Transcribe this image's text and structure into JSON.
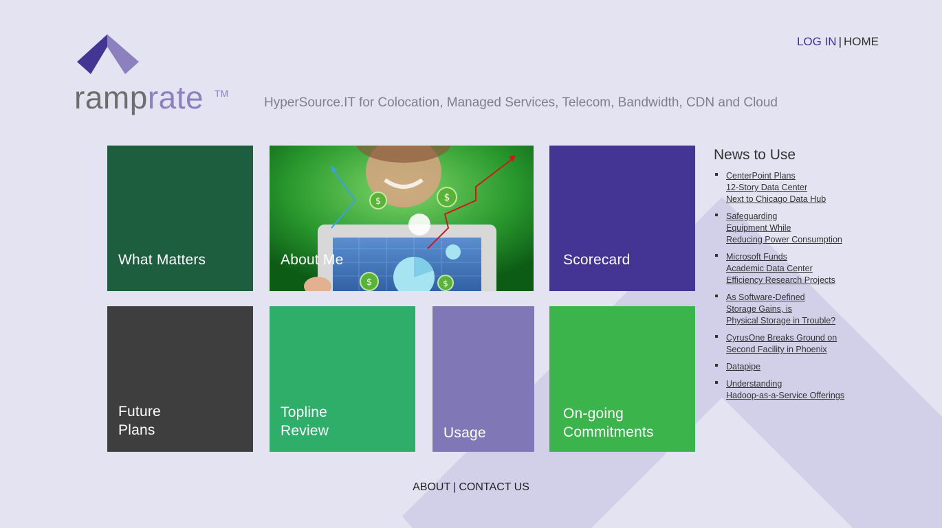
{
  "brand": {
    "word_ramp": "ramp",
    "word_rate": "rate",
    "tm": "TM",
    "tagline": "HyperSource.IT for Colocation, Managed Services, Telecom, Bandwidth, CDN and Cloud",
    "colors": {
      "accent": "#8d80be",
      "dark_accent": "#3e3490",
      "background": "#e4e3f1"
    }
  },
  "topnav": {
    "login": "LOG IN",
    "separator": "|",
    "home": "HOME"
  },
  "tiles": {
    "what_matters": {
      "label": "What Matters",
      "color": "#1c5e3e"
    },
    "about_me": {
      "label": "About Me"
    },
    "scorecard": {
      "label": "Scorecard",
      "color": "#443595"
    },
    "future_plans": {
      "line1": "Future",
      "line2": "Plans",
      "color": "#3e3e3e"
    },
    "topline_review": {
      "line1": "Topline",
      "line2": "Review",
      "color": "#2fae6a"
    },
    "usage": {
      "label": "Usage",
      "color": "#8078b6"
    },
    "ongoing": {
      "line1": "On-going",
      "line2": "Commitments",
      "color": "#3cb44c"
    }
  },
  "news": {
    "title": "News to Use",
    "items": [
      {
        "text": "CenterPoint Plans\n12-Story Data Center\nNext to Chicago Data Hub"
      },
      {
        "text": "Safeguarding\nEquipment While\nReducing Power Consumption"
      },
      {
        "text": "Microsoft Funds\nAcademic Data Center\nEfficiency Research Projects"
      },
      {
        "text": "As Software-Defined\nStorage Gains, is\nPhysical Storage in Trouble?"
      },
      {
        "text": "CyrusOne Breaks Ground on\nSecond Facility in Phoenix"
      },
      {
        "text": "Datapipe"
      },
      {
        "text": "Understanding\nHadoop-as-a-Service Offerings"
      }
    ]
  },
  "footer": {
    "about": "ABOUT",
    "separator": "|",
    "contact": "CONTACT US"
  },
  "about_image": {
    "coin_symbol": "$"
  }
}
